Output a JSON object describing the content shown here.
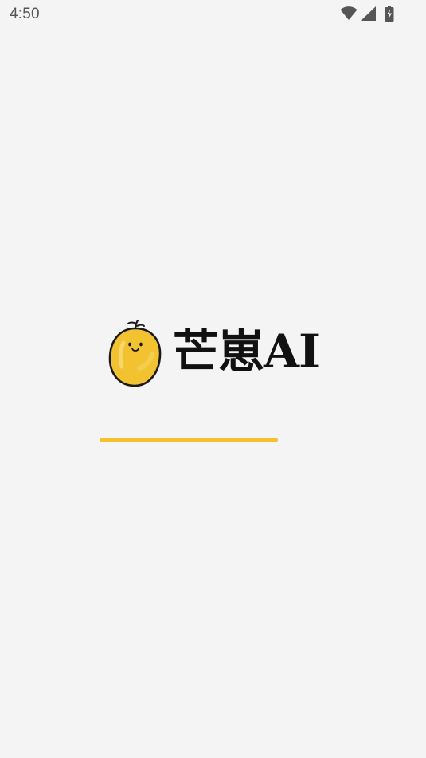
{
  "status_bar": {
    "time": "4:50",
    "icons": [
      "wifi-icon",
      "cellular-signal-icon",
      "battery-charging-icon"
    ],
    "icon_color": "#555555"
  },
  "splash": {
    "logo_icon": "mango-mascot-icon",
    "brand_name": "芒崽AI",
    "progress": 1.0,
    "accent_color": "#f5c12e",
    "background_color": "#f4f4f4"
  }
}
